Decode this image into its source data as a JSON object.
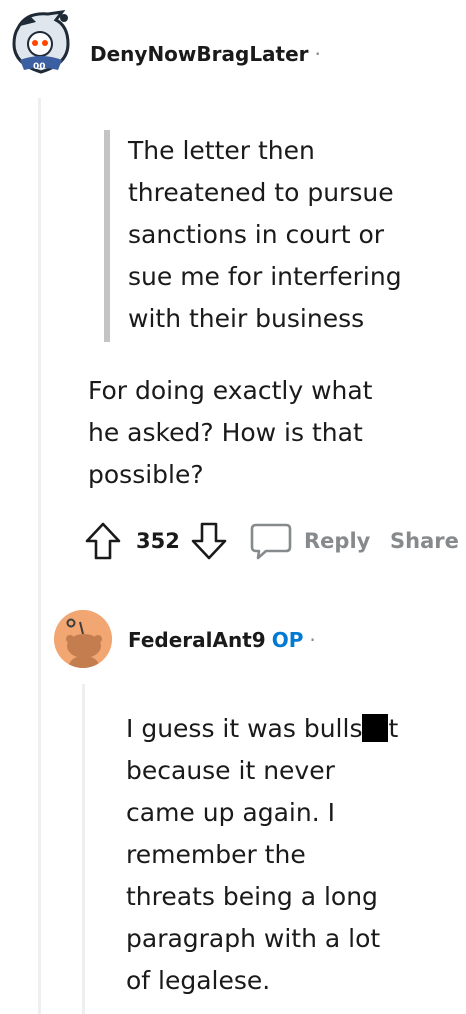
{
  "comment1": {
    "username": "DenyNowBragLater",
    "separator": "·",
    "quote_lines": [
      "The letter then",
      "threatened to pursue",
      "sanctions in court or",
      "sue me for interfering",
      "with their business"
    ],
    "body_lines": [
      "For doing exactly what",
      "he asked? How is that",
      "possible?"
    ],
    "votes": "352",
    "reply_label": "Reply",
    "share_label": "Share"
  },
  "comment2": {
    "username": "FederalAnt9",
    "op_badge": "OP",
    "separator": "·",
    "body_first_prefix": "I guess it was bulls",
    "body_first_suffix": "t",
    "body_lines": [
      "because it never",
      "came up again. I",
      "remember the",
      "threats being a long",
      "paragraph with a lot",
      "of legalese."
    ]
  },
  "icons": {
    "avatar1": "snoo-avatar-eagles-helmet-icon",
    "avatar2": "snoo-avatar-default-orange-icon",
    "upvote": "upvote-arrow-icon",
    "downvote": "downvote-arrow-icon",
    "comment": "comment-bubble-icon"
  },
  "colors": {
    "op_badge": "#0079d3",
    "muted": "#878a8c",
    "avatar2_bg": "#f2a672",
    "avatar1_bg": "#dfe6ed"
  }
}
